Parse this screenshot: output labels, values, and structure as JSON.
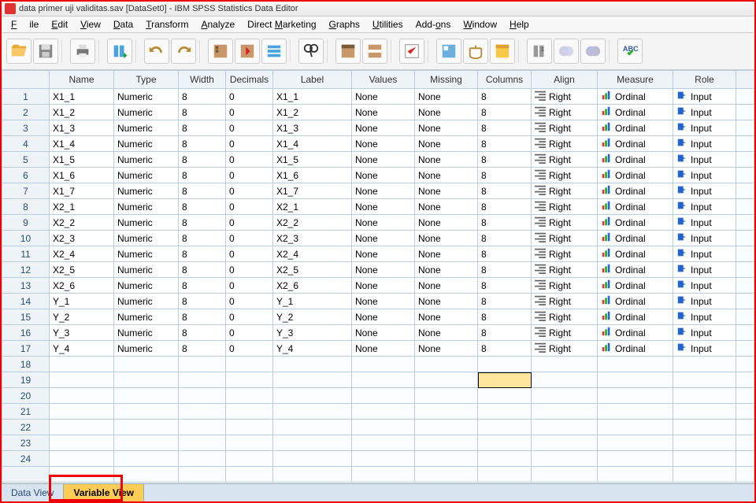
{
  "window": {
    "title": "data primer uji validitas.sav [DataSet0] - IBM SPSS Statistics Data Editor"
  },
  "menu": {
    "file": "File",
    "edit": "Edit",
    "view": "View",
    "data": "Data",
    "transform": "Transform",
    "analyze": "Analyze",
    "direct": "Direct Marketing",
    "graphs": "Graphs",
    "utilities": "Utilities",
    "addons": "Add-ons",
    "window": "Window",
    "help": "Help"
  },
  "columns": {
    "name": "Name",
    "type": "Type",
    "width": "Width",
    "decimals": "Decimals",
    "label": "Label",
    "values": "Values",
    "missing": "Missing",
    "columns_": "Columns",
    "align": "Align",
    "measure": "Measure",
    "role": "Role"
  },
  "defaults": {
    "type": "Numeric",
    "width": "8",
    "decimals": "0",
    "values": "None",
    "missing": "None",
    "columns": "8",
    "align": "Right",
    "measure": "Ordinal",
    "role": "Input"
  },
  "vars": [
    {
      "n": "1",
      "name": "X1_1",
      "label": "X1_1"
    },
    {
      "n": "2",
      "name": "X1_2",
      "label": "X1_2"
    },
    {
      "n": "3",
      "name": "X1_3",
      "label": "X1_3"
    },
    {
      "n": "4",
      "name": "X1_4",
      "label": "X1_4"
    },
    {
      "n": "5",
      "name": "X1_5",
      "label": "X1_5"
    },
    {
      "n": "6",
      "name": "X1_6",
      "label": "X1_6"
    },
    {
      "n": "7",
      "name": "X1_7",
      "label": "X1_7"
    },
    {
      "n": "8",
      "name": "X2_1",
      "label": "X2_1"
    },
    {
      "n": "9",
      "name": "X2_2",
      "label": "X2_2"
    },
    {
      "n": "10",
      "name": "X2_3",
      "label": "X2_3"
    },
    {
      "n": "11",
      "name": "X2_4",
      "label": "X2_4"
    },
    {
      "n": "12",
      "name": "X2_5",
      "label": "X2_5"
    },
    {
      "n": "13",
      "name": "X2_6",
      "label": "X2_6"
    },
    {
      "n": "14",
      "name": "Y_1",
      "label": "Y_1"
    },
    {
      "n": "15",
      "name": "Y_2",
      "label": "Y_2"
    },
    {
      "n": "16",
      "name": "Y_3",
      "label": "Y_3"
    },
    {
      "n": "17",
      "name": "Y_4",
      "label": "Y_4"
    }
  ],
  "emptyRows": [
    "18",
    "19",
    "20",
    "21",
    "22",
    "23",
    "24"
  ],
  "tabs": {
    "data": "Data View",
    "variable": "Variable View"
  },
  "selectedCell": {
    "row": 19,
    "col": "columns"
  }
}
